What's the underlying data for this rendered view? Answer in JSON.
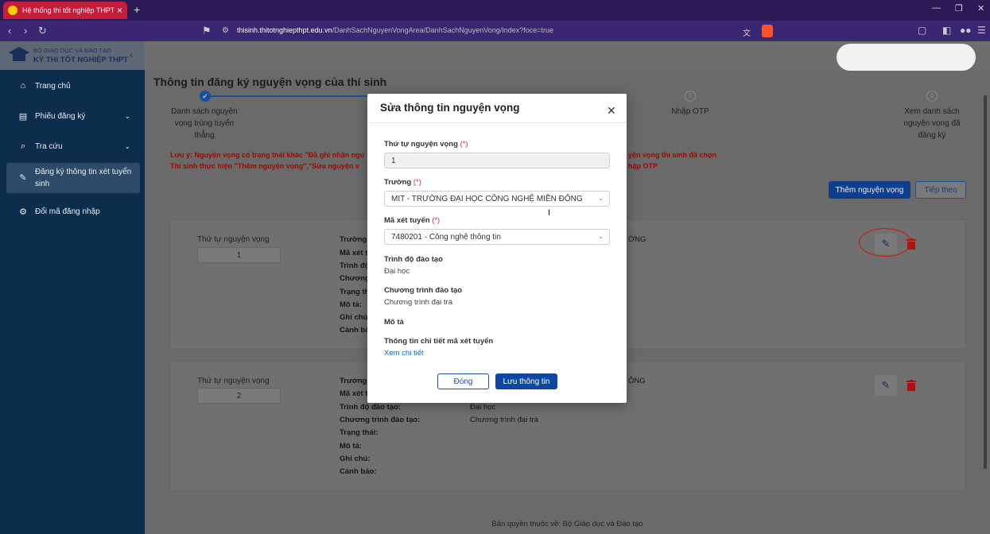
{
  "browser": {
    "tab_title": "Hệ thống thi tốt nghiệp THPT",
    "url_host": "thisinh.thitotnghiepthpt.edu.vn",
    "url_path": "/DanhSachNguyenVongArea/DanhSachNguyenVong/Index?foce=true"
  },
  "logo": {
    "top": "BỘ GIÁO DỤC VÀ ĐÀO TẠO",
    "main": "KỲ THI TỐT NGHIỆP THPT"
  },
  "sidebar": {
    "items": [
      {
        "label": "Trang chủ",
        "icon": "home-icon"
      },
      {
        "label": "Phiếu đăng ký",
        "icon": "document-icon"
      },
      {
        "label": "Tra cứu",
        "icon": "search-icon"
      },
      {
        "label": "Đăng ký thông tin xét tuyển sinh",
        "icon": "edit-icon"
      },
      {
        "label": "Đổi mã đăng nhập",
        "icon": "gear-icon"
      }
    ]
  },
  "main": {
    "title": "Thông tin đăng ký nguyện vọng của thí sinh",
    "steps": [
      {
        "label": "Danh sách nguyện vọng trúng tuyển thẳng"
      },
      {
        "label": "Nhập OTP",
        "number": "3"
      },
      {
        "label": "Xem danh sách nguyện vọng đã đăng ký",
        "number": "4"
      }
    ],
    "warning_1a": "Lưu ý: Nguyện vọng có trạng thái khác \"Đã ghi nhận ngu",
    "warning_1b": "yện vọng thí sinh đã chọn",
    "warning_2a": "Thí sinh thực hiện \"Thêm nguyện vọng\",\"Sửa nguyện v",
    "warning_2b": "hập OTP",
    "add_button": "Thêm nguyện vọng",
    "next_button": "Tiếp theo",
    "wish_order_label": "Thứ tự nguyện vọng",
    "wishes": [
      {
        "order": "1",
        "labels_cut": [
          "Trường:",
          "Mã xét t",
          "Trình độ",
          "Chương",
          "Trạng th",
          "Mô tả:",
          "Ghi chú:",
          "Cảnh bá"
        ],
        "school_tail": "ỜNG"
      },
      {
        "order": "2",
        "labels": [
          "Trường:",
          "Mã xét t",
          "Trình độ đào tạo:",
          "Chương trình đào tạo:",
          "Trạng thái:",
          "Mô tả:",
          "Ghi chú:",
          "Cảnh báo:"
        ],
        "school_tail": "ÔNG",
        "level": "Đại học",
        "program": "Chương trình đại trà"
      }
    ]
  },
  "footer": "Bản quyền thuộc về: Bộ Giáo dục và Đào tạo",
  "modal": {
    "title": "Sửa thông tin nguyện vọng",
    "order_label": "Thứ tự nguyện vọng",
    "required": "(*)",
    "order_value": "1",
    "school_label": "Trường",
    "school_value": "MIT - TRƯỜNG ĐẠI HỌC CÔNG NGHỆ MIỀN ĐÔNG",
    "code_label": "Mã xét tuyển",
    "code_value": "7480201 - Công nghệ thông tin",
    "level_label": "Trình độ đào tạo",
    "level_value": "Đại học",
    "program_label": "Chương trình đào tạo",
    "program_value": "Chương trình đại trà",
    "desc_label": "Mô tả",
    "detail_label": "Thông tin chi tiết mã xét tuyển",
    "detail_link": "Xem chi tiết",
    "close_button": "Đóng",
    "save_button": "Lưu thông tin"
  }
}
